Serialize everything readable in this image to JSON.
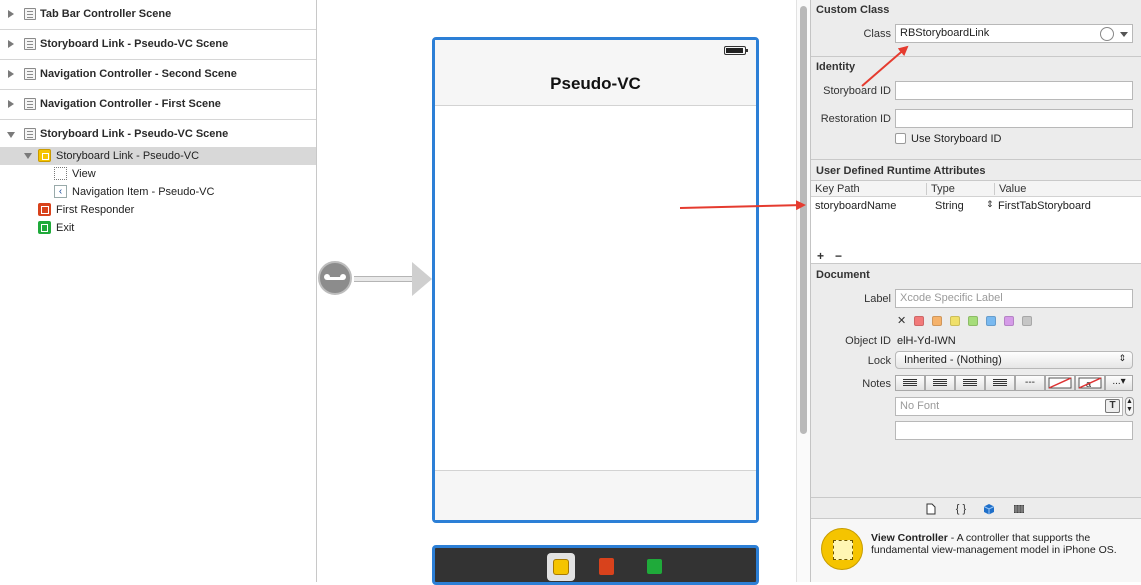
{
  "outline": {
    "scenes": [
      "Tab Bar Controller Scene",
      "Storyboard Link - Pseudo-VC Scene",
      "Navigation Controller - Second Scene",
      "Navigation Controller - First Scene",
      "Storyboard Link - Pseudo-VC Scene"
    ],
    "tree": {
      "controller": "Storyboard Link - Pseudo-VC",
      "view": "View",
      "nav_item": "Navigation Item - Pseudo-VC",
      "first_responder": "First Responder",
      "exit": "Exit"
    }
  },
  "canvas": {
    "vc_title": "Pseudo-VC"
  },
  "inspector": {
    "custom_class": {
      "title": "Custom Class",
      "class_label": "Class",
      "class_value": "RBStoryboardLink"
    },
    "identity": {
      "title": "Identity",
      "storyboard_id_label": "Storyboard ID",
      "storyboard_id_value": "",
      "restoration_id_label": "Restoration ID",
      "restoration_id_value": "",
      "use_storyboard_id_label": "Use Storyboard ID"
    },
    "runtime_attrs": {
      "title": "User Defined Runtime Attributes",
      "col_key_path": "Key Path",
      "col_type": "Type",
      "col_value": "Value",
      "rows": [
        {
          "key_path": "storyboardName",
          "type": "String",
          "value": "FirstTabStoryboard"
        }
      ],
      "add": "+",
      "remove": "−"
    },
    "document": {
      "title": "Document",
      "label_label": "Label",
      "label_placeholder": "Xcode Specific Label",
      "clear_mark": "✕",
      "swatches": [
        "#f27a7a",
        "#f5b26b",
        "#f0e06a",
        "#a6dd7a",
        "#79b9f0",
        "#d59be8",
        "#c6c6c6"
      ],
      "object_id_label": "Object ID",
      "object_id_value": "elH-Yd-IWN",
      "lock_label": "Lock",
      "lock_value": "Inherited - (Nothing)",
      "notes_label": "Notes",
      "notes_dashes": "---",
      "notes_more": "...",
      "font_placeholder": "No Font",
      "font_icon": "T"
    },
    "footer_icons": [
      "file-icon",
      "braces-icon",
      "cube-icon",
      "grid-icon"
    ],
    "footer_braces": "{ }",
    "library": {
      "name": "View Controller",
      "description": " - A controller that supports the fundamental view-management model in iPhone OS."
    }
  },
  "colors": {
    "selection_blue": "#2c7fd6",
    "annotation_red": "#e53b2f",
    "vc_yellow": "#f5c400"
  }
}
